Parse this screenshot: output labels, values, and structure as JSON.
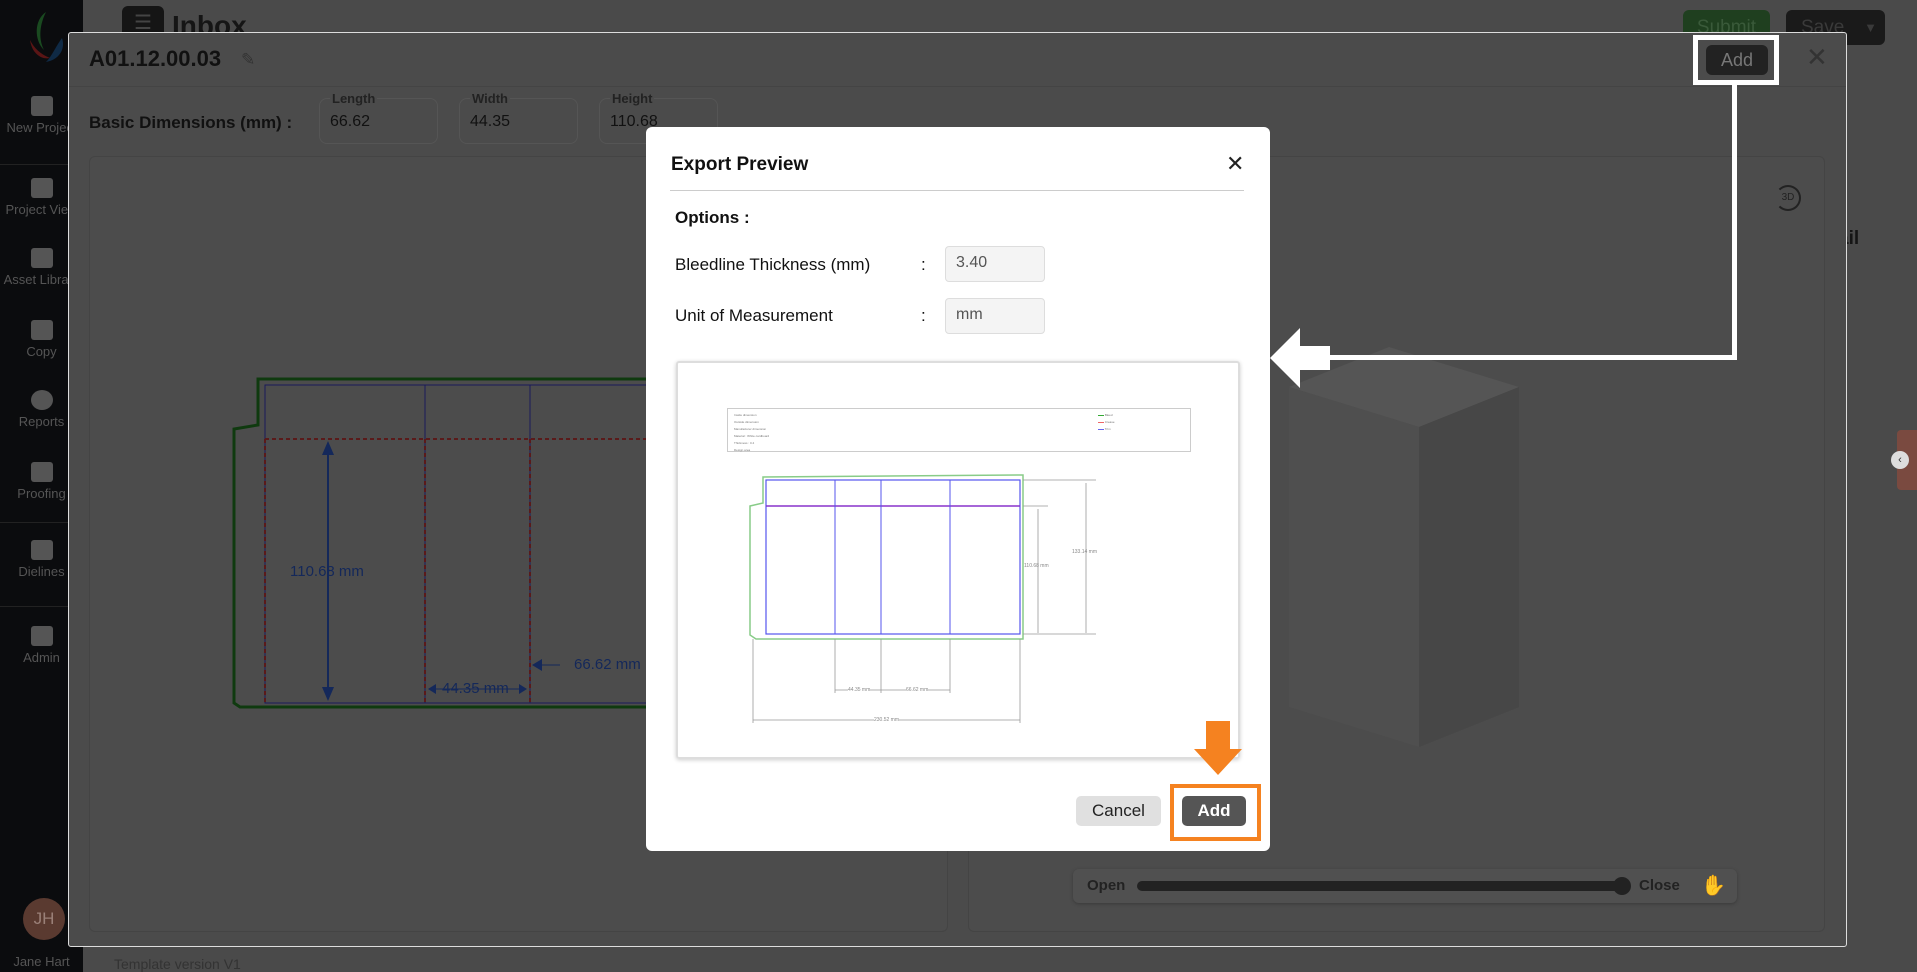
{
  "sidebar": {
    "items": [
      {
        "label": "New Project"
      },
      {
        "label": "Project View"
      },
      {
        "label": "Asset Library"
      },
      {
        "label": "Copy"
      },
      {
        "label": "Reports"
      },
      {
        "label": "Proofing"
      },
      {
        "label": "Dielines"
      },
      {
        "label": "Admin"
      }
    ],
    "user_initials": "JH",
    "user_name": "Jane Hart"
  },
  "header": {
    "title": "Inbox",
    "submit": "Submit",
    "save": "Save",
    "table_header_partial": "ail"
  },
  "editor": {
    "title": "A01.12.00.03",
    "add_label": "Add",
    "basic_dimensions_label": "Basic Dimensions (mm) :",
    "length_label": "Length",
    "length": "66.62",
    "width_label": "Width",
    "width": "44.35",
    "height_label": "Height",
    "height": "110.68",
    "template_version": "Template version V1",
    "dieline_labels": {
      "height": "110.68 mm",
      "width": "44.35 mm",
      "length": "66.62 mm"
    },
    "view3d_label": "3D",
    "slider": {
      "open": "Open",
      "close": "Close",
      "value": 1.0
    }
  },
  "export_modal": {
    "title": "Export Preview",
    "options_label": "Options :",
    "bleed_label": "Bleedline Thickness (mm)",
    "bleed_value": "3.40",
    "unit_label": "Unit of Measurement",
    "unit_value": "mm",
    "colon": ":",
    "cancel": "Cancel",
    "add": "Add",
    "preview": {
      "info_lines": [
        "Inside dimension",
        "Outside dimension",
        "Manufacturer dimension",
        "Material : White cardboard",
        "Thickness : 0.4",
        "Design area"
      ],
      "legend": [
        "Bleed",
        "Crease",
        "Trim"
      ],
      "dims": {
        "height_inner": "110.68 mm",
        "height_outer": "133.14 mm",
        "width": "44.35 mm",
        "length": "66.62 mm",
        "total": "230.52 mm"
      }
    }
  },
  "colors": {
    "highlight": "#f58220",
    "annotation": "#ffffff",
    "bleed": "#3a9a3a",
    "trim": "#3333ee",
    "crease": "#cc2222"
  }
}
